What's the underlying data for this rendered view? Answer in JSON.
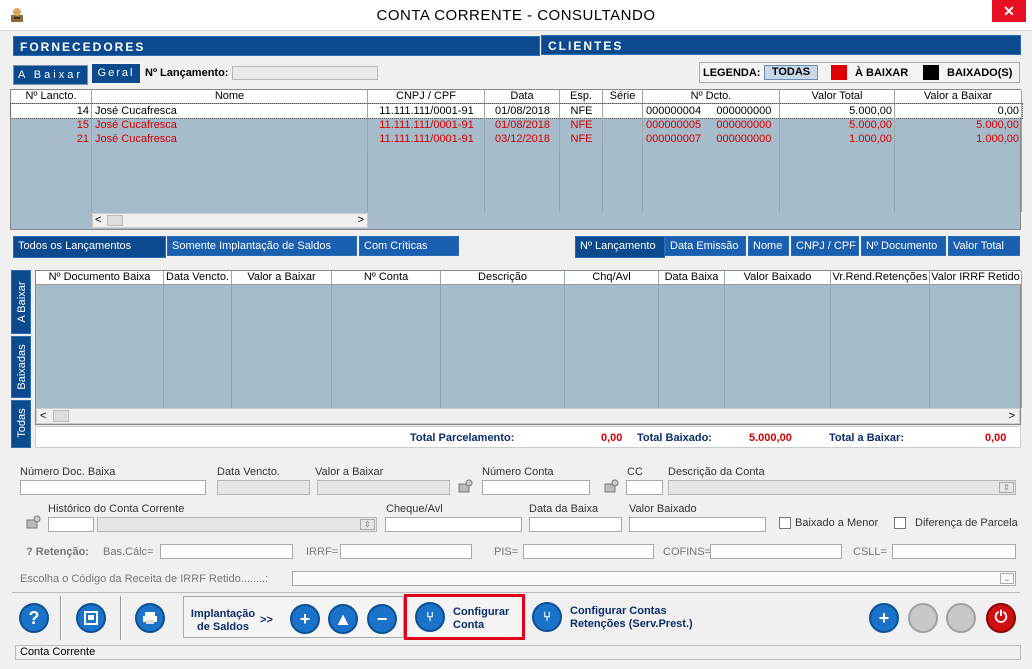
{
  "window": {
    "title": "CONTA CORRENTE   -   CONSULTANDO",
    "close": "✕"
  },
  "sections": {
    "fornecedores": "FORNECEDORES",
    "clientes": "CLIENTES"
  },
  "tabs": {
    "a_baixar": "A Baixar",
    "geral": "Geral"
  },
  "lancamento_label": "Nº Lançamento:",
  "legend": {
    "label": "LEGENDA:",
    "todas": "TODAS",
    "a_baixar": "À BAIXAR",
    "baixados": "BAIXADO(S)",
    "colors": {
      "a_baixar": "#e00000",
      "baixados": "#000000"
    }
  },
  "main_table": {
    "headers": [
      "Nº Lancto.",
      "Nome",
      "CNPJ / CPF",
      "Data",
      "Esp.",
      "Série",
      "Nº Dcto.",
      "Valor Total",
      "Valor a Baixar"
    ],
    "rows": [
      {
        "lancto": "14",
        "nome": "José Cucafresca",
        "cnpj": "11.111.111/0001-91",
        "data": "01/08/2018",
        "esp": "NFE",
        "serie": "",
        "dcto1": "000000004",
        "dcto2": "000000000",
        "total": "5.000,00",
        "baixar": "0,00",
        "status": "baixado"
      },
      {
        "lancto": "15",
        "nome": "José Cucafresca",
        "cnpj": "11.111.111/0001-91",
        "data": "01/08/2018",
        "esp": "NFE",
        "serie": "",
        "dcto1": "000000005",
        "dcto2": "000000000",
        "total": "5.000,00",
        "baixar": "5.000,00",
        "status": "a_baixar"
      },
      {
        "lancto": "21",
        "nome": "José Cucafresca",
        "cnpj": "11.111.111/0001-91",
        "data": "03/12/2018",
        "esp": "NFE",
        "serie": "",
        "dcto1": "000000007",
        "dcto2": "000000000",
        "total": "1.000,00",
        "baixar": "1.000,00",
        "status": "a_baixar"
      }
    ]
  },
  "filter_buttons": [
    "Todos os Lançamentos",
    "Somente Implantação de Saldos",
    "Com Críticas"
  ],
  "sort_buttons": [
    "Nº Lançamento",
    "Data Emissão",
    "Nome",
    "CNPJ / CPF",
    "Nº Documento",
    "Valor Total"
  ],
  "vertical_tabs": [
    "A Baixar",
    "Baixadas",
    "Todas"
  ],
  "detail_table": {
    "headers": [
      "Nº Documento Baixa",
      "Data Vencto.",
      "Valor a Baixar",
      "Nº Conta",
      "Descrição",
      "Chq/Avl",
      "Data Baixa",
      "Valor Baixado",
      "Vr.Rend.Retenções",
      "Valor IRRF Retido"
    ]
  },
  "totals": {
    "parcelamento_label": "Total Parcelamento:",
    "parcelamento": "0,00",
    "baixado_label": "Total Baixado:",
    "baixado": "5.000,00",
    "a_baixar_label": "Total a Baixar:",
    "a_baixar": "0,00"
  },
  "form": {
    "numero_doc_baixa": "Número Doc. Baixa",
    "data_vencto": "Data Vencto.",
    "valor_a_baixar": "Valor a Baixar",
    "numero_conta": "Número Conta",
    "cc": "CC",
    "descricao_conta": "Descrição da Conta",
    "historico": "Histórico do Conta Corrente",
    "cheque": "Cheque/Avl",
    "data_baixa": "Data da Baixa",
    "valor_baixado": "Valor Baixado",
    "baixado_menor": "Baixado a Menor",
    "diferenca_parcela": "Diferença de Parcela",
    "retencao": "? Retenção:",
    "bas_calc": "Bas.Cálc=",
    "irrf": "IRRF=",
    "pis": "PIS=",
    "cofins": "COFINS=",
    "csll": "CSLL=",
    "receita_irrf": "Escolha o Código da Receita de IRRF Retido........:"
  },
  "toolbar": {
    "help": "?",
    "implantacao": "Implantação\nde Saldos",
    "arrows": ">>",
    "configurar_conta": "Configurar\nConta",
    "configurar_contas": "Configurar Contas\nRetenções (Serv.Prest.)"
  },
  "status_bar": "Conta Corrente"
}
